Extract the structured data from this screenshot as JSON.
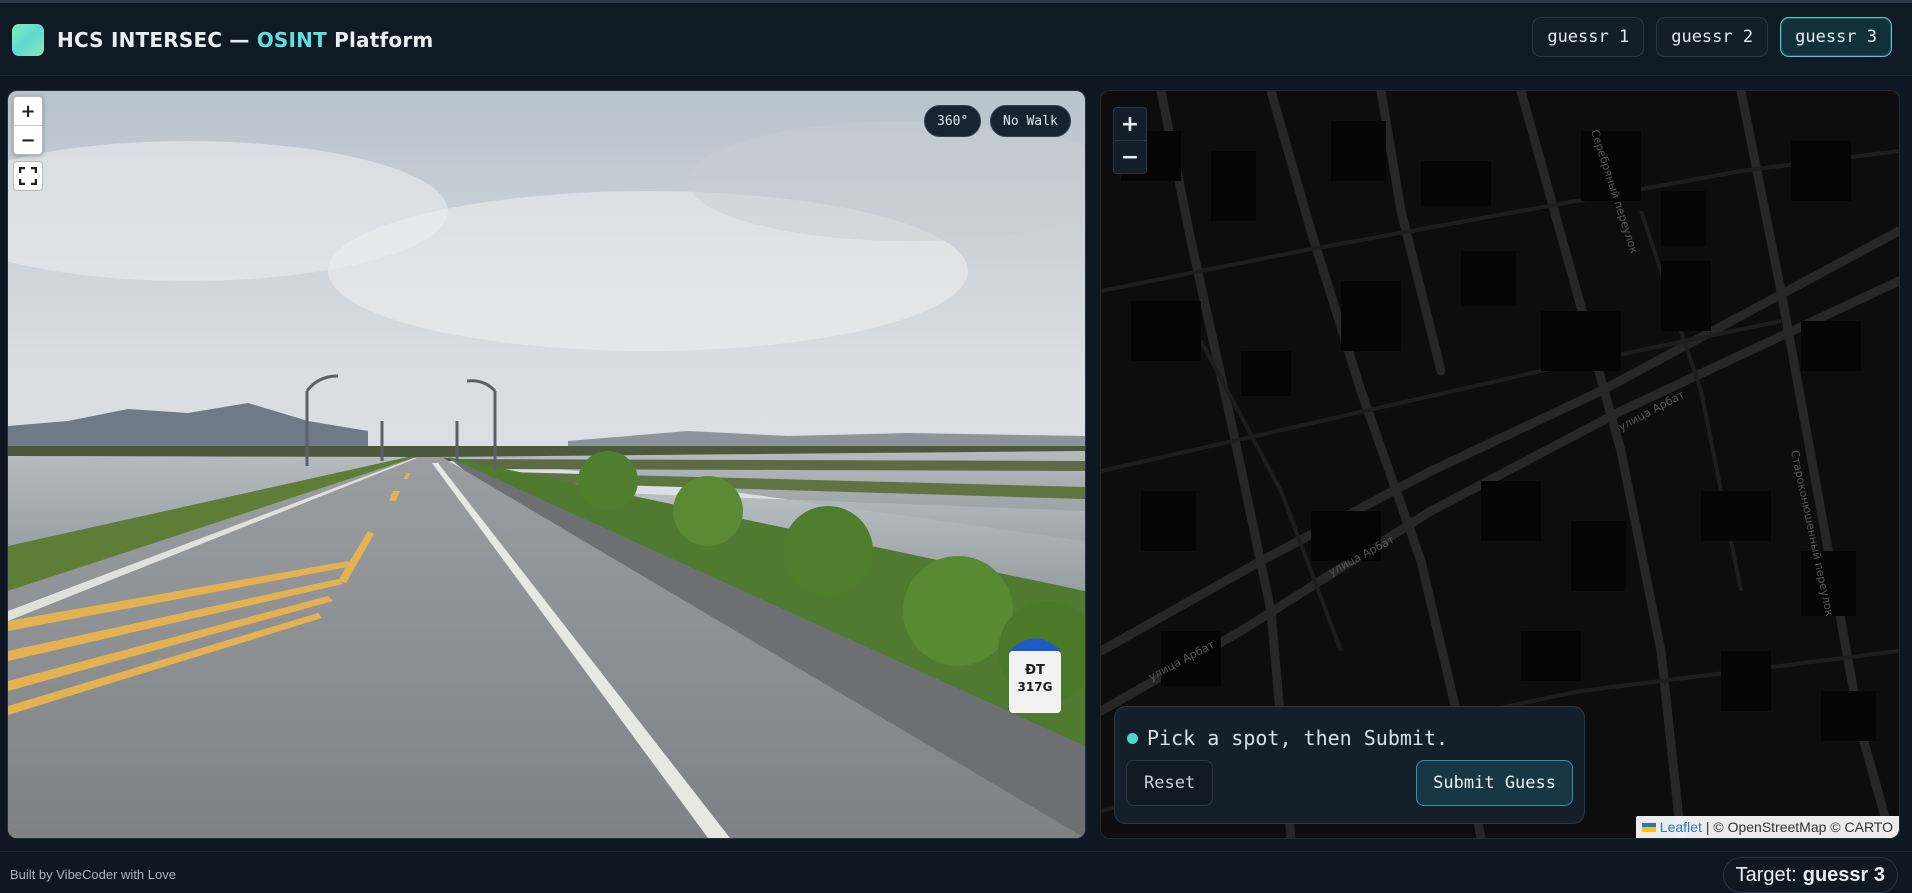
{
  "header": {
    "brand_prefix": "HCS INTERSEC — ",
    "brand_accent": "OSINT",
    "brand_suffix": " Platform",
    "tabs": [
      {
        "label": "guessr 1",
        "active": false
      },
      {
        "label": "guessr 2",
        "active": false
      },
      {
        "label": "guessr 3",
        "active": true
      }
    ]
  },
  "panorama": {
    "zoom_in": "+",
    "zoom_out": "−",
    "badge_360": "360°",
    "badge_walk": "No Walk",
    "milestone_line1": "ĐT",
    "milestone_line2": "317G"
  },
  "map": {
    "zoom_in": "+",
    "zoom_out": "−",
    "street_labels": [
      "улица Арбат",
      "улица Арбат",
      "улица Арбат",
      "Серебряный переулок",
      "Староконюшенный переулок"
    ],
    "status_text": "Pick a spot, then Submit.",
    "reset_label": "Reset",
    "submit_label": "Submit Guess",
    "attribution_link": "Leaflet",
    "attribution_text": "| © OpenStreetMap © CARTO"
  },
  "footer": {
    "credit": "Built by VibeCoder with Love",
    "target_label": "Target:",
    "target_value": "guessr 3"
  },
  "colors": {
    "accent": "#5ee0e0",
    "background": "#0f1822",
    "status_dot": "#4fd8c8"
  }
}
